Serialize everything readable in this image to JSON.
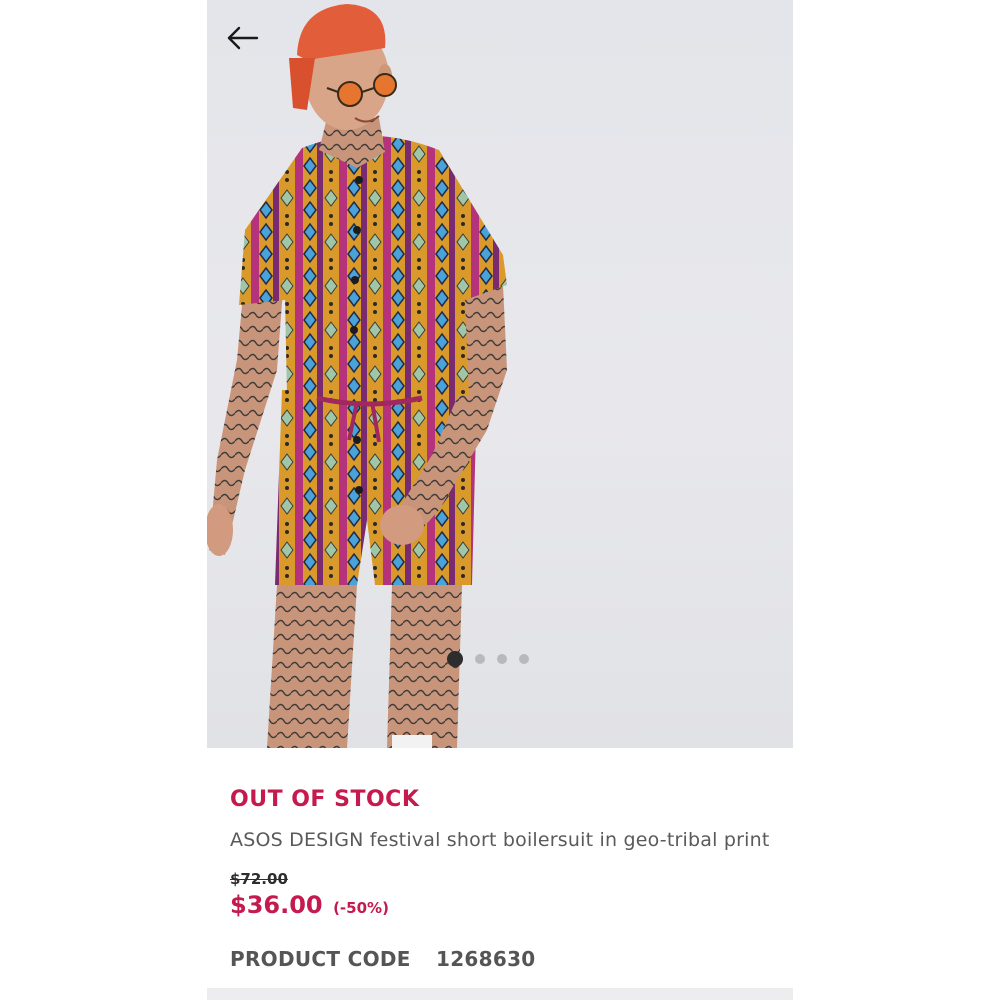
{
  "gallery": {
    "image_description_icon": "model-wearing-patterned-boilersuit",
    "dots_total": 4,
    "active_dot": 0
  },
  "product": {
    "stock_status": "OUT OF STOCK",
    "title": "ASOS DESIGN festival short boilersuit in geo-tribal print",
    "was_price": "$72.00",
    "now_price": "$36.00",
    "discount": "(-50%)",
    "code_label": "PRODUCT CODE",
    "code_value": "1268630"
  },
  "colors": {
    "accent": "#c41a4e",
    "text_dark": "#2d2d2d",
    "text_muted": "#5a5a5a",
    "image_bg": "#e6e6ea"
  }
}
